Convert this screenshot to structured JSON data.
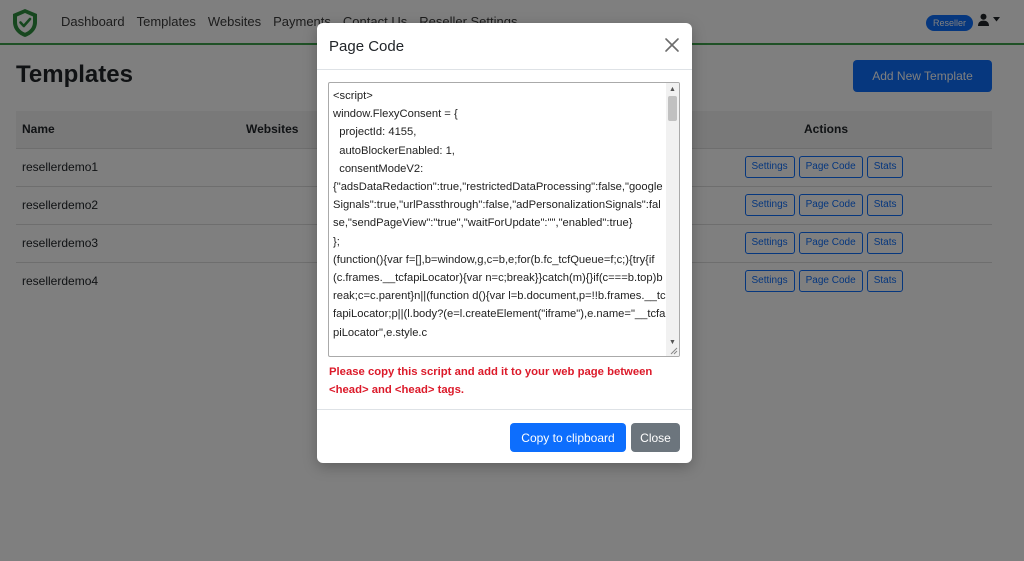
{
  "navbar": {
    "links": [
      "Dashboard",
      "Templates",
      "Websites",
      "Payments",
      "Contact Us",
      "Reseller Settings"
    ],
    "badge": "Reseller"
  },
  "page": {
    "title": "Templates",
    "add_button": "Add New Template"
  },
  "table": {
    "headers": {
      "name": "Name",
      "websites": "Websites",
      "actions": "Actions"
    },
    "rows": [
      {
        "name": "resellerdemo1"
      },
      {
        "name": "resellerdemo2"
      },
      {
        "name": "resellerdemo3"
      },
      {
        "name": "resellerdemo4"
      }
    ],
    "action_labels": {
      "settings": "Settings",
      "page_code": "Page Code",
      "stats": "Stats"
    }
  },
  "modal": {
    "title": "Page Code",
    "code": "<script>\nwindow.FlexyConsent = {\n  projectId: 4155,\n  autoBlockerEnabled: 1,\n  consentModeV2:\n{\"adsDataRedaction\":true,\"restrictedDataProcessing\":false,\"googleSignals\":true,\"urlPassthrough\":false,\"adPersonalizationSignals\":false,\"sendPageView\":\"true\",\"waitForUpdate\":\"\",\"enabled\":true}\n};\n(function(){var f=[],b=window,g,c=b,e;for(b.fc_tcfQueue=f;c;){try{if(c.frames.__tcfapiLocator){var n=c;break}}catch(m){}if(c===b.top)break;c=c.parent}n||(function d(){var l=b.document,p=!!b.frames.__tcfapiLocator;p||(l.body?(e=l.createElement(\"iframe\"),e.name=\"__tcfapiLocator\",e.style.c",
    "warning": "Please copy this script and add it to your web page between <head> and <head> tags.",
    "copy_button": "Copy to clipboard",
    "close_button": "Close"
  },
  "colors": {
    "primary": "#0d6efd",
    "brand_green": "#3fa34d",
    "warning_red": "#dc1a2a",
    "secondary": "#6c757d"
  }
}
